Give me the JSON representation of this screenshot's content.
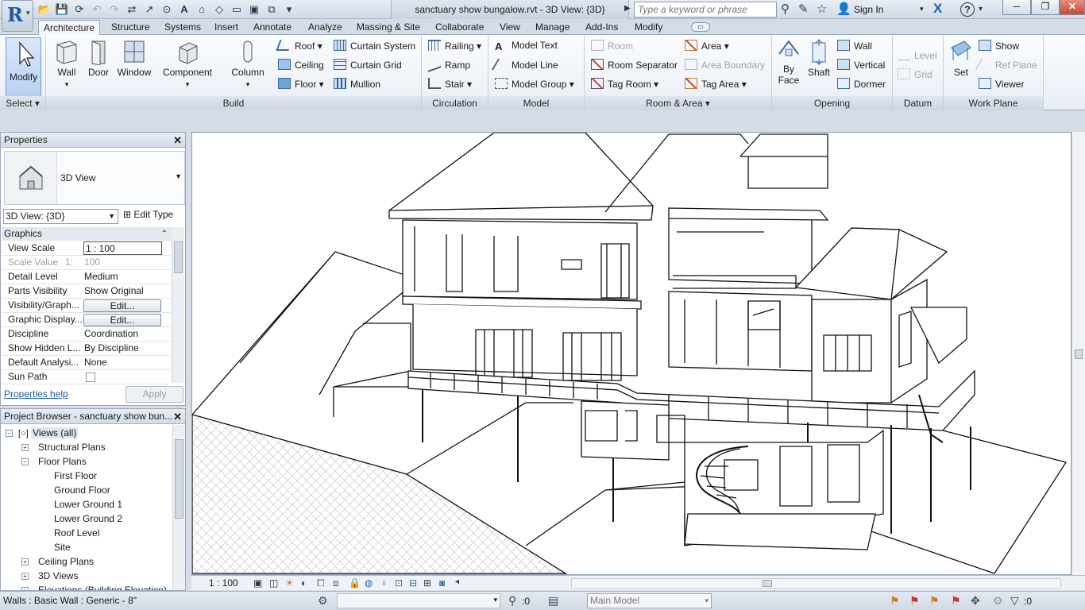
{
  "app": {
    "logo_letter": "R",
    "doc_title": "sanctuary show bungalow.rvt - 3D View: {3D}",
    "search_placeholder": "Type a keyword or phrase",
    "sign_in": "Sign In",
    "minimize_glyph": "─",
    "restore_glyph": "❐",
    "close_glyph": "✕"
  },
  "tabs": [
    "Architecture",
    "Structure",
    "Systems",
    "Insert",
    "Annotate",
    "Analyze",
    "Massing & Site",
    "Collaborate",
    "View",
    "Manage",
    "Add-Ins",
    "Modify"
  ],
  "ribbon": {
    "select": {
      "modify": "Modify",
      "title": "Select"
    },
    "build": {
      "title": "Build",
      "wall": "Wall",
      "door": "Door",
      "window": "Window",
      "component": "Component",
      "column": "Column",
      "roof": "Roof",
      "ceiling": "Ceiling",
      "floor": "Floor",
      "curtain_system": "Curtain System",
      "curtain_grid": "Curtain Grid",
      "mullion": "Mullion"
    },
    "circulation": {
      "title": "Circulation",
      "railing": "Railing",
      "ramp": "Ramp",
      "stair": "Stair"
    },
    "model": {
      "title": "Model",
      "model_text": "Model Text",
      "model_line": "Model Line",
      "model_group": "Model Group"
    },
    "room_area": {
      "title": "Room & Area",
      "room": "Room",
      "room_separator": "Room Separator",
      "tag_room": "Tag Room",
      "area": "Area",
      "area_boundary": "Area Boundary",
      "tag_area": "Tag Area"
    },
    "opening": {
      "title": "Opening",
      "by_face_1": "By",
      "by_face_2": "Face",
      "shaft": "Shaft",
      "wall": "Wall",
      "vertical": "Vertical",
      "dormer": "Dormer"
    },
    "datum": {
      "title": "Datum",
      "level": "Level",
      "grid": "Grid"
    },
    "work_plane": {
      "title": "Work Plane",
      "set": "Set",
      "show": "Show",
      "ref_plane": "Ref Plane",
      "viewer": "Viewer"
    }
  },
  "properties": {
    "title": "Properties",
    "type_name": "3D View",
    "view_selector": "3D View: {3D}",
    "edit_type": "Edit Type",
    "section": "Graphics",
    "rows": [
      {
        "name": "View Scale",
        "value": "1 : 100"
      },
      {
        "name": "Scale Value",
        "value": "1:",
        "value2": "100"
      },
      {
        "name": "Detail Level",
        "value": "Medium"
      },
      {
        "name": "Parts Visibility",
        "value": "Show Original"
      },
      {
        "name": "Visibility/Graph...",
        "value": "Edit..."
      },
      {
        "name": "Graphic Display...",
        "value": "Edit..."
      },
      {
        "name": "Discipline",
        "value": "Coordination"
      },
      {
        "name": "Show Hidden L...",
        "value": "By Discipline"
      },
      {
        "name": "Default Analysi...",
        "value": "None"
      },
      {
        "name": "Sun Path",
        "value": ""
      }
    ],
    "help": "Properties help",
    "apply": "Apply"
  },
  "browser": {
    "title": "Project Browser - sanctuary show bun...",
    "root": "Views (all)",
    "structural_plans": "Structural Plans",
    "floor_plans": "Floor Plans",
    "floors": [
      "First Floor",
      "Ground Floor",
      "Lower Ground 1",
      "Lower Ground 2",
      "Roof Level",
      "Site"
    ],
    "ceiling_plans": "Ceiling Plans",
    "views_3d": "3D Views",
    "elevations": "Elevations (Building Elevation)"
  },
  "viewbar": {
    "scale": "1 : 100"
  },
  "status": {
    "selection": "Walls : Basic Wall : Generic - 8\"",
    "zero": ":0",
    "workset": "Main Model",
    "filter": ":0"
  },
  "colors": {
    "accent": "#1d5aa8",
    "panel_bg": "#d6dde6",
    "ribbon_title": "#cdd7e4"
  }
}
